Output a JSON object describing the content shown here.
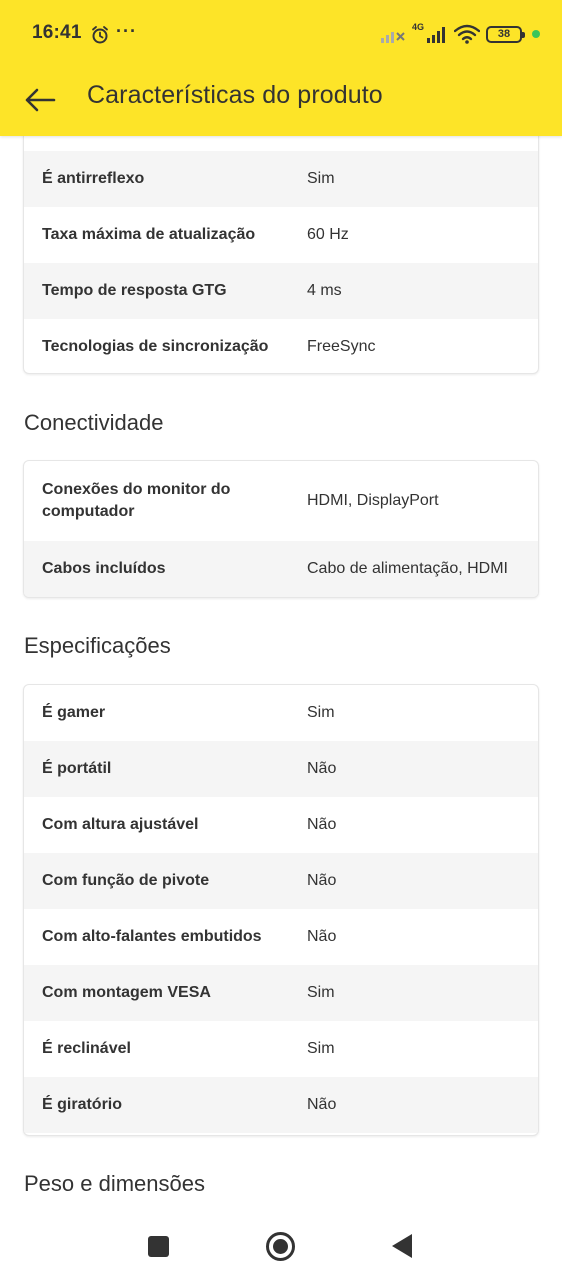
{
  "status_bar": {
    "time": "16:41",
    "more": "···",
    "network": "4G",
    "battery": "38",
    "icons": [
      "alarm-icon",
      "signal-off-icon",
      "signal-icon",
      "wifi-icon",
      "battery-icon"
    ]
  },
  "app_bar": {
    "title": "Características do produto",
    "back_icon": "arrow-left-icon"
  },
  "sections": {
    "display_rows": [
      {
        "label": "É antirreflexo",
        "value": "Sim"
      },
      {
        "label": "Taxa máxima de atualização",
        "value": "60 Hz"
      },
      {
        "label": "Tempo de resposta GTG",
        "value": "4 ms"
      },
      {
        "label": "Tecnologias de sincronização",
        "value": "FreeSync"
      }
    ],
    "conectividade": {
      "title": "Conectividade",
      "rows": [
        {
          "label": "Conexões do monitor do computador",
          "value": "HDMI, DisplayPort"
        },
        {
          "label": "Cabos incluídos",
          "value": "Cabo de alimentação, HDMI"
        }
      ]
    },
    "especificacoes": {
      "title": "Especificações",
      "rows": [
        {
          "label": "É gamer",
          "value": "Sim"
        },
        {
          "label": "É portátil",
          "value": "Não"
        },
        {
          "label": "Com altura ajustável",
          "value": "Não"
        },
        {
          "label": "Com função de pivote",
          "value": "Não"
        },
        {
          "label": "Com alto-falantes embutidos",
          "value": "Não"
        },
        {
          "label": "Com montagem VESA",
          "value": "Sim"
        },
        {
          "label": "É reclinável",
          "value": "Sim"
        },
        {
          "label": "É giratório",
          "value": "Não"
        }
      ]
    },
    "peso": {
      "title": "Peso e dimensões"
    }
  },
  "nav_bar": {
    "icons": [
      "recent-apps-icon",
      "home-icon",
      "back-icon"
    ]
  },
  "colors": {
    "header": "#fde428",
    "row_gray": "#f5f5f5",
    "text": "#333333"
  }
}
